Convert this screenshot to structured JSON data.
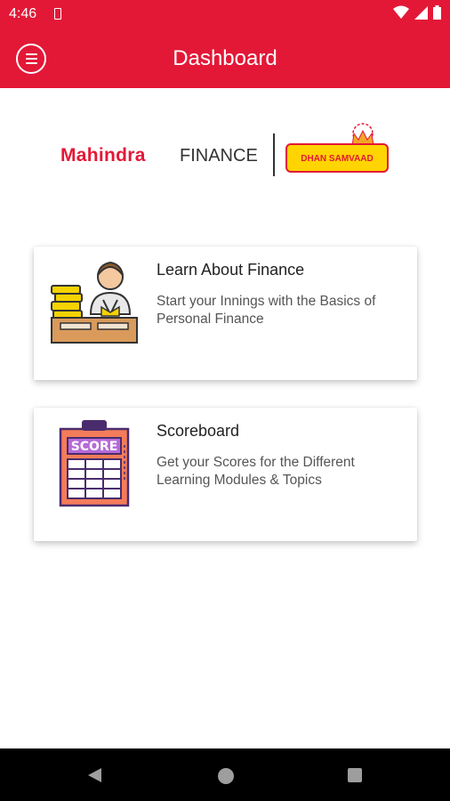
{
  "status_bar": {
    "time": "4:46"
  },
  "app_bar": {
    "title": "Dashboard"
  },
  "brand": {
    "mahindra": "Mahindra",
    "finance": "FINANCE",
    "dhan": "DHAN",
    "samvaad": "SAMVAAD"
  },
  "cards": [
    {
      "title": "Learn About Finance",
      "description": "Start your Innings with the Basics of Personal Finance",
      "icon": "teacher-books-icon"
    },
    {
      "title": "Scoreboard",
      "description": "Get your Scores for the Different Learning Modules & Topics",
      "icon": "score-clipboard-icon",
      "icon_text": "SCORE"
    }
  ],
  "nav_bar": {
    "buttons": [
      "back",
      "home",
      "recents"
    ]
  },
  "colors": {
    "primary": "#e31837",
    "accent": "#ffd400"
  }
}
